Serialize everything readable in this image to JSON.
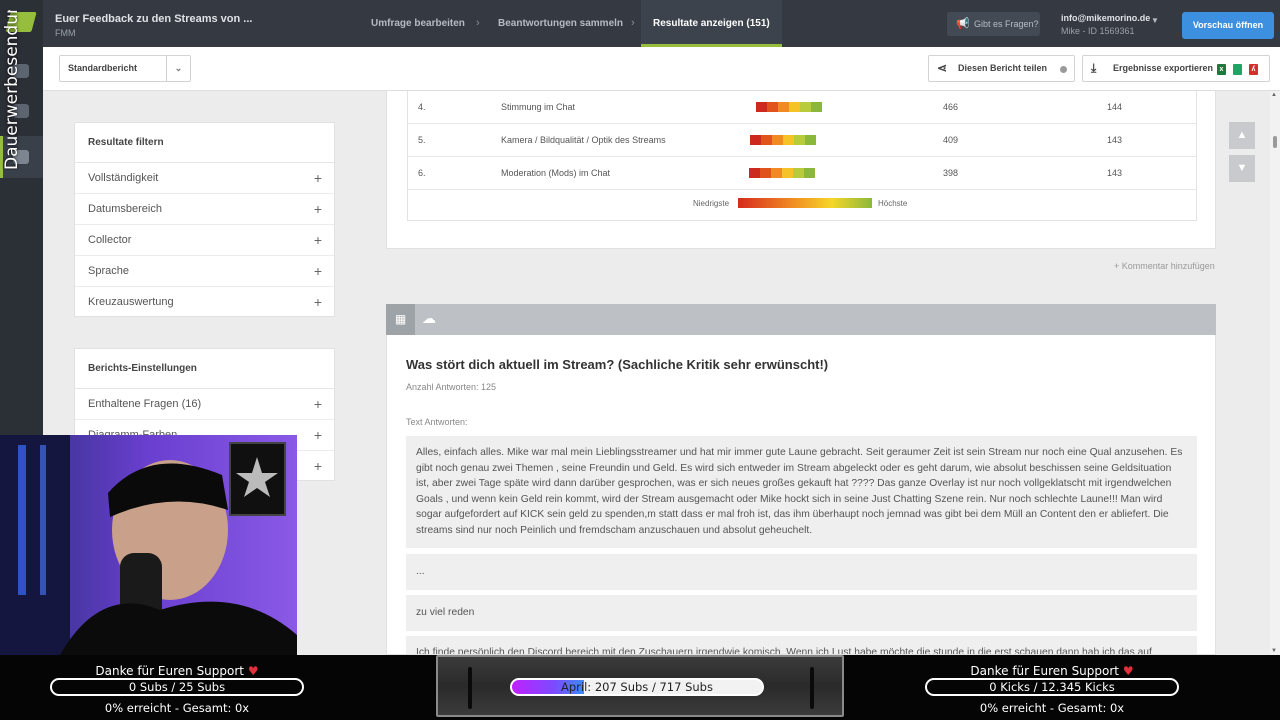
{
  "overlay_vertical_text": "Dauerwerbesendung",
  "survey": {
    "title": "Euer Feedback zu den Streams von ...",
    "subtitle": "FMM"
  },
  "steps": [
    {
      "label": "Umfrage bearbeiten",
      "active": false
    },
    {
      "label": "Beantwortungen sammeln",
      "active": false
    },
    {
      "label": "Resultate anzeigen (151)",
      "active": true
    }
  ],
  "help_label": "Gibt es Fragen?",
  "account": {
    "email": "info@mikemorino.de",
    "id_line": "Mike - ID 1569361"
  },
  "preview_label": "Vorschau öffnen",
  "toolbar": {
    "report_select": "Standardbericht",
    "share_label": "Diesen Bericht teilen",
    "export_label": "Ergebnisse exportieren",
    "export_formats": [
      {
        "name": "excel-icon",
        "color": "#1e7a3c"
      },
      {
        "name": "sheets-icon",
        "color": "#21a366"
      },
      {
        "name": "pdf-icon",
        "color": "#d0312d"
      }
    ]
  },
  "filter_panel": {
    "title": "Resultate filtern",
    "items": [
      "Vollständigkeit",
      "Datumsbereich",
      "Collector",
      "Sprache",
      "Kreuzauswertung"
    ]
  },
  "settings_panel": {
    "title": "Berichts-Einstellungen",
    "items": [
      "Enthaltene Fragen (16)",
      "Diagramm-Farben",
      ""
    ]
  },
  "ranking_rows": [
    {
      "rank": "4.",
      "label": "Stimmung im Chat",
      "score": "466",
      "count": "144"
    },
    {
      "rank": "5.",
      "label": "Kamera / Bildqualität / Optik des Streams",
      "score": "409",
      "count": "143"
    },
    {
      "rank": "6.",
      "label": "Moderation (Mods) im Chat",
      "score": "398",
      "count": "143"
    }
  ],
  "heatmap_colors": [
    "#cc2a1f",
    "#e0531c",
    "#f08a22",
    "#f5c227",
    "#b9cb3a",
    "#8bb83a"
  ],
  "legend": {
    "low": "Niedrigste",
    "high": "Höchste"
  },
  "add_comment": "+ Kommentar hinzufügen",
  "question": {
    "title": "Was stört dich aktuell im Stream? (Sachliche Kritik sehr erwünscht!)",
    "count_label": "Anzahl Antworten: 125",
    "text_label": "Text Antworten:",
    "answers": [
      "Alles, einfach alles. Mike war mal mein Lieblingsstreamer und hat mir immer gute Laune gebracht. Seit geraumer Zeit ist sein Stream nur noch eine Qual anzusehen. Es gibt noch genau zwei Themen , seine Freundin und Geld. Es wird sich entweder im Stream abgeleckt oder es geht darum, wie absolut beschissen seine Geldsituation ist, aber zwei Tage späte wird dann darüber gesprochen, was er sich neues großes gekauft hat ???? Das ganze Overlay ist nur noch vollgeklatscht mit irgendwelchen Goals , und wenn kein Geld rein kommt, wird der Stream ausgemacht oder Mike hockt sich in seine Just Chatting Szene rein. Nur noch schlechte Laune!!! Man wird sogar aufgefordert auf KICK sein geld zu spenden,m statt dass er mal froh ist, das ihm überhaupt noch jemnad was gibt bei dem Müll an Content den er abliefert. Die streams sind nur noch Peinlich und fremdscham anzuschauen und absolut geheuchelt.",
      "...",
      "zu viel reden",
      "Ich finde persönlich den Discord bereich mit den Zuschauern irgendwie komisch. Wenn ich Lust habe möchte die stunde in die erst schauen dann hab ich das auf"
    ]
  },
  "stream_overlay": {
    "left": {
      "title": "Danke für Euren Support",
      "bar": "0 Subs / 25 Subs",
      "status": "0% erreicht - Gesamt: 0x"
    },
    "center": {
      "bar": "April: 207 Subs / 717 Subs",
      "progress": 0.289
    },
    "right": {
      "title": "Danke für Euren Support",
      "bar": "0 Kicks / 12.345 Kicks",
      "status": "0% erreicht - Gesamt: 0x"
    },
    "heart": "♥"
  }
}
